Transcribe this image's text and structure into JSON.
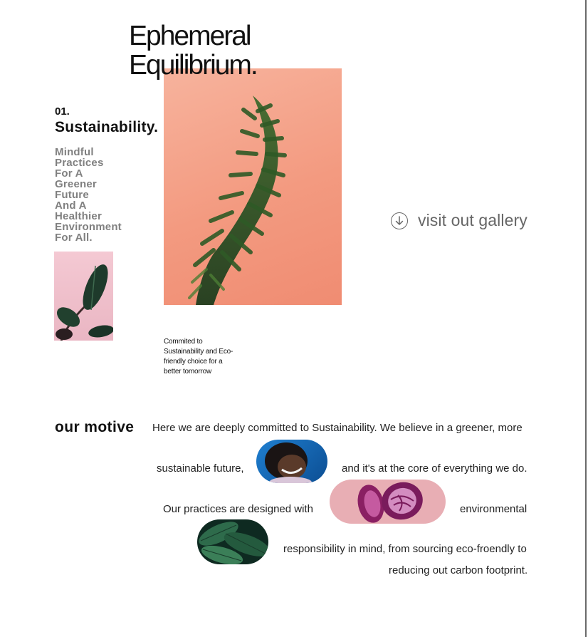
{
  "hero": {
    "title_line1": "Ephemeral",
    "title_line2": "Equilibrium."
  },
  "section": {
    "number": "01.",
    "title": "Sustainability.",
    "tagline_lines": [
      "Mindful",
      "Practices",
      "For A",
      "Greener",
      "Future",
      "And A",
      "Healthier",
      "Environment",
      "For All."
    ]
  },
  "caption_lines": [
    "Commited to",
    "Sustainability and Eco-",
    "friendly choice for a",
    "better tomorrow"
  ],
  "gallery": {
    "label": "visit out gallery",
    "icon": "arrow-down-circle-icon"
  },
  "motive": {
    "title": "our motive",
    "line1": "Here we are deeply committed to Sustainability. We believe in a greener, more",
    "line2a": "sustainable future,",
    "line2b": "and it's at the core of everything we do.",
    "line3a": "Our practices are designed with",
    "line3b": "environmental",
    "line4": "responsibility in mind, from sourcing eco-froendly to",
    "line5": "reducing out carbon footprint."
  },
  "colors": {
    "hero_background": "#f39a80",
    "tagline": "#808080",
    "gallery_text": "#666666"
  }
}
